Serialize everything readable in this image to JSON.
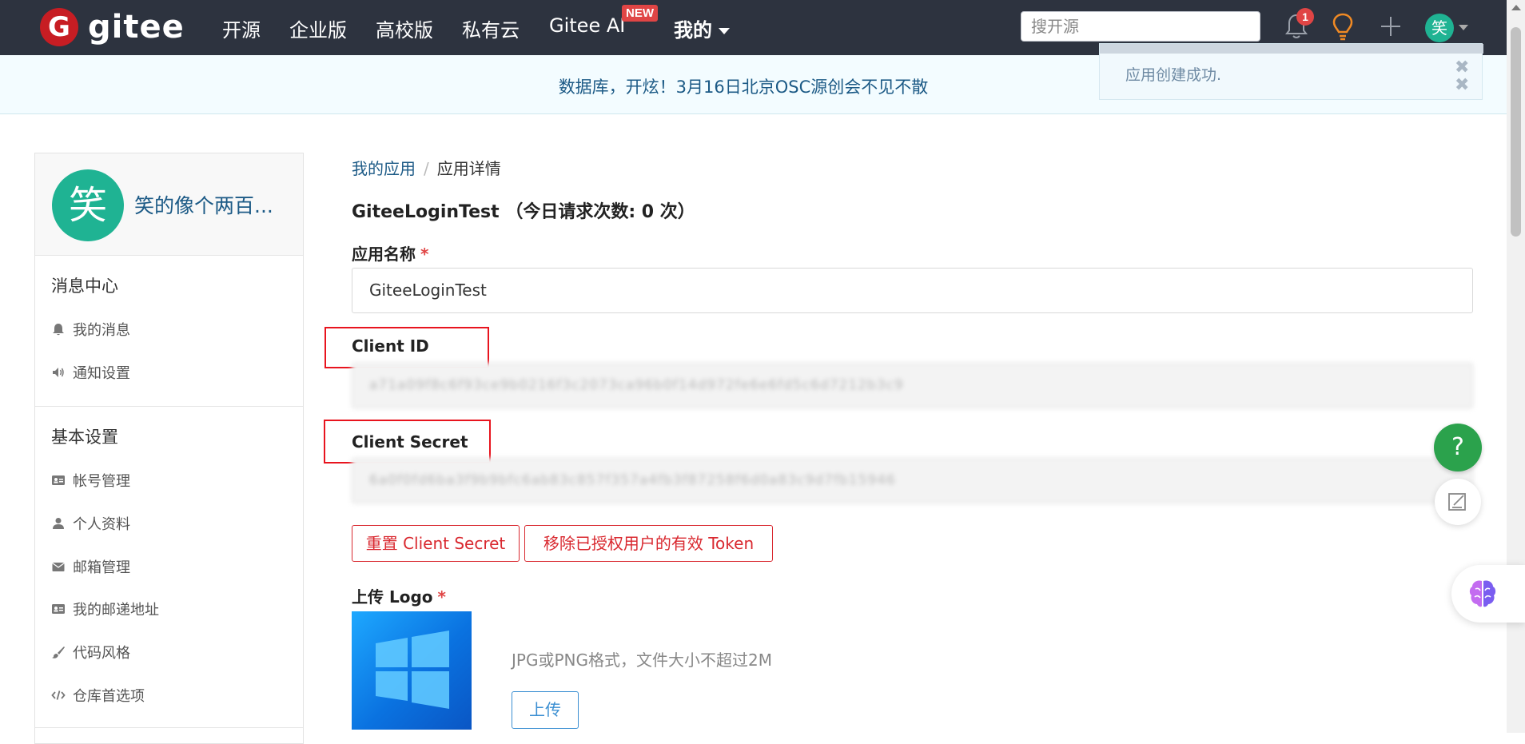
{
  "nav": {
    "logo_letter": "G",
    "logo_text": "gitee",
    "items": [
      "开源",
      "企业版",
      "高校版",
      "私有云",
      "Gitee AI"
    ],
    "new_badge": "NEW",
    "me_label": "我的",
    "search_placeholder": "搜开源",
    "notification_count": "1",
    "avatar_char": "笑"
  },
  "banner": {
    "text": "数据库，开炫！3月16日北京OSC源创会不见不散"
  },
  "toast": {
    "text": "应用创建成功.",
    "close_symbol": "✖"
  },
  "sidebar": {
    "avatar_char": "笑",
    "user_name": "笑的像个两百...",
    "section1_title": "消息中心",
    "section1_items": [
      "我的消息",
      "通知设置"
    ],
    "section2_title": "基本设置",
    "section2_items": [
      "帐号管理",
      "个人资料",
      "邮箱管理",
      "我的邮递地址",
      "代码风格",
      "仓库首选项"
    ]
  },
  "breadcrumb": {
    "parent": "我的应用",
    "separator": "/",
    "current": "应用详情"
  },
  "app": {
    "title": "GiteeLoginTest （今日请求次数: 0 次）",
    "name_label": "应用名称",
    "required_mark": "*",
    "name_value": "GiteeLoginTest",
    "client_id_label": "Client ID",
    "client_id_value": "a71a09f8c6f93ce9b0216f3c2073ca96b0f14d972fe6e6fd5c6d7212b3c9",
    "client_secret_label": "Client Secret",
    "client_secret_value": "6a0f0fd6ba3f9b9bfc6ab83c857f357a4fb3f87258f6d0a83c9d7fb15946",
    "reset_button": "重置 Client Secret",
    "revoke_button": "移除已授权用户的有效 Token",
    "logo_label": "上传 Logo",
    "logo_hint": "JPG或PNG格式，文件大小不超过2M",
    "upload_button": "上传"
  },
  "floating": {
    "help_symbol": "?"
  },
  "colors": {
    "nav_bg": "#2d333f",
    "brand_red": "#c71d23",
    "link_blue": "#1c5a86",
    "accent_green": "#1fb393",
    "highlight_red": "#e8141e"
  }
}
